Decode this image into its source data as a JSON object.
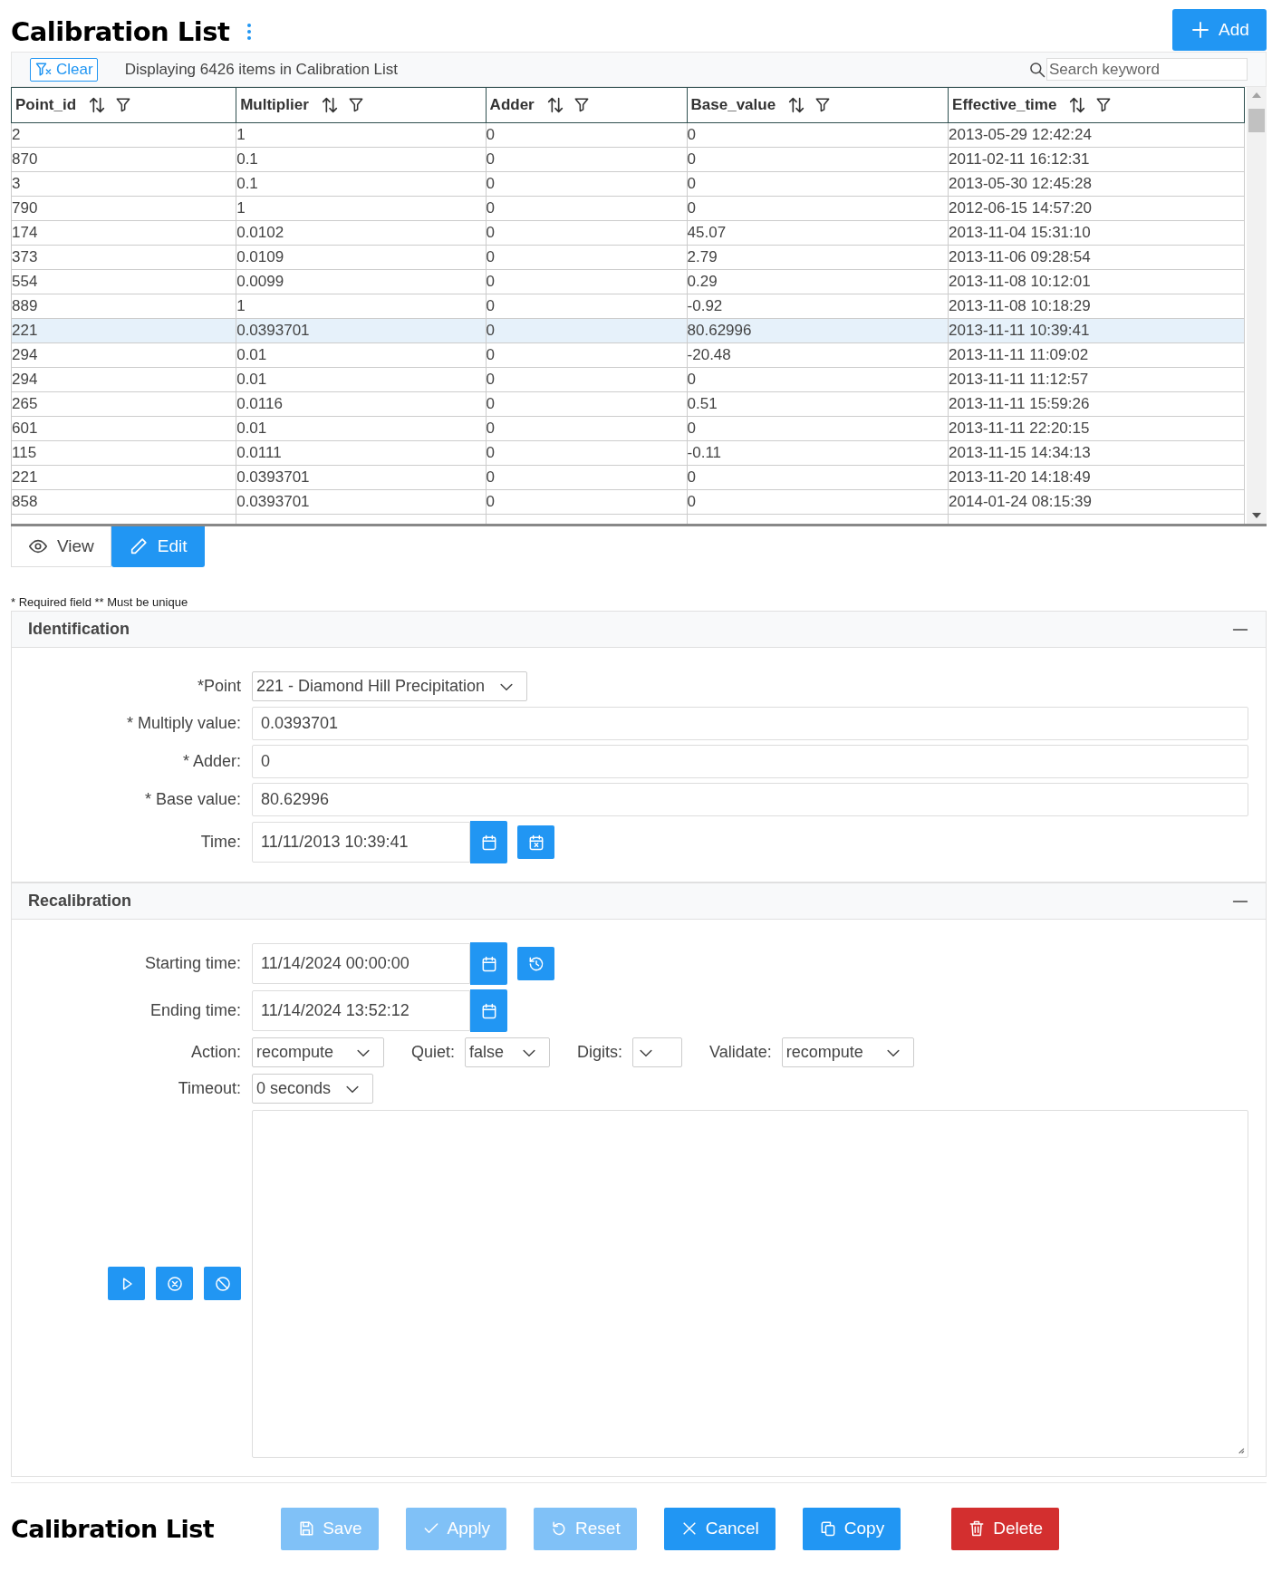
{
  "header": {
    "title": "Calibration List",
    "add_label": "Add"
  },
  "toolbar": {
    "clear_label": "Clear",
    "summary": "Displaying 6426 items in Calibration List",
    "search_placeholder": "Search keyword"
  },
  "table": {
    "columns": [
      "Point_id",
      "Multiplier",
      "Adder",
      "Base_value",
      "Effective_time"
    ],
    "rows": [
      {
        "cells": [
          "2",
          "1",
          "0",
          "0",
          "2013-05-29 12:42:24"
        ],
        "selected": false
      },
      {
        "cells": [
          "870",
          "0.1",
          "0",
          "0",
          "2011-02-11 16:12:31"
        ],
        "selected": false
      },
      {
        "cells": [
          "3",
          "0.1",
          "0",
          "0",
          "2013-05-30 12:45:28"
        ],
        "selected": false
      },
      {
        "cells": [
          "790",
          "1",
          "0",
          "0",
          "2012-06-15 14:57:20"
        ],
        "selected": false
      },
      {
        "cells": [
          "174",
          "0.0102",
          "0",
          "45.07",
          "2013-11-04 15:31:10"
        ],
        "selected": false
      },
      {
        "cells": [
          "373",
          "0.0109",
          "0",
          "2.79",
          "2013-11-06 09:28:54"
        ],
        "selected": false
      },
      {
        "cells": [
          "554",
          "0.0099",
          "0",
          "0.29",
          "2013-11-08 10:12:01"
        ],
        "selected": false
      },
      {
        "cells": [
          "889",
          "1",
          "0",
          "-0.92",
          "2013-11-08 10:18:29"
        ],
        "selected": false
      },
      {
        "cells": [
          "221",
          "0.0393701",
          "0",
          "80.62996",
          "2013-11-11 10:39:41"
        ],
        "selected": true
      },
      {
        "cells": [
          "294",
          "0.01",
          "0",
          "-20.48",
          "2013-11-11 11:09:02"
        ],
        "selected": false
      },
      {
        "cells": [
          "294",
          "0.01",
          "0",
          "0",
          "2013-11-11 11:12:57"
        ],
        "selected": false
      },
      {
        "cells": [
          "265",
          "0.0116",
          "0",
          "0.51",
          "2013-11-11 15:59:26"
        ],
        "selected": false
      },
      {
        "cells": [
          "601",
          "0.01",
          "0",
          "0",
          "2013-11-11 22:20:15"
        ],
        "selected": false
      },
      {
        "cells": [
          "115",
          "0.0111",
          "0",
          "-0.11",
          "2013-11-15 14:34:13"
        ],
        "selected": false
      },
      {
        "cells": [
          "221",
          "0.0393701",
          "0",
          "0",
          "2013-11-20 14:18:49"
        ],
        "selected": false
      },
      {
        "cells": [
          "858",
          "0.0393701",
          "0",
          "0",
          "2014-01-24 08:15:39"
        ],
        "selected": false
      }
    ]
  },
  "tabs": [
    {
      "label": "View",
      "kind": "view",
      "selected": false
    },
    {
      "label": "Edit",
      "kind": "edit",
      "selected": true
    }
  ],
  "legend": "* Required field ** Must be unique",
  "panels": [
    {
      "title": "Identification",
      "expanded": true,
      "fields": [
        {
          "kind": "select",
          "label": "*Point",
          "value": "221 - Diamond Hill Precipitation"
        },
        {
          "kind": "text",
          "label": "* Multiply value:",
          "value": "0.0393701"
        },
        {
          "kind": "text",
          "label": "* Adder:",
          "value": "0"
        },
        {
          "kind": "text",
          "label": "* Base value:",
          "value": "80.62996"
        },
        {
          "kind": "datetime",
          "label": "Time:",
          "value": "11/11/2013 10:39:41",
          "actions": [
            {
              "kind": "clear-date"
            }
          ]
        }
      ]
    },
    {
      "title": "Recalibration",
      "expanded": true,
      "fields": [
        {
          "kind": "datetime",
          "label": "Starting time:",
          "value": "11/14/2024 00:00:00",
          "actions": [
            {
              "kind": "history"
            }
          ]
        },
        {
          "kind": "datetime",
          "label": "Ending time:",
          "value": "11/14/2024 13:52:12"
        },
        {
          "kind": "select-row",
          "selects": [
            {
              "label": "Action:",
              "value": "recompute"
            },
            {
              "label": "Quiet:",
              "value": "false"
            },
            {
              "label": "Digits:"
            },
            {
              "label": "Validate:",
              "value": "recompute"
            }
          ]
        },
        {
          "kind": "select",
          "label": "Timeout:",
          "value": "0 seconds"
        },
        {
          "kind": "output",
          "buttons": [
            {
              "kind": "play"
            },
            {
              "kind": "stop"
            },
            {
              "kind": "abort"
            }
          ]
        }
      ]
    }
  ],
  "footer": {
    "title": "Calibration List",
    "buttons": [
      {
        "label": "Save",
        "kind": "save",
        "disabled": true
      },
      {
        "label": "Apply",
        "kind": "apply",
        "disabled": true
      },
      {
        "label": "Reset",
        "kind": "reset",
        "disabled": true
      },
      {
        "label": "Cancel",
        "kind": "cancel",
        "disabled": false
      },
      {
        "label": "Copy",
        "kind": "copy",
        "disabled": false
      },
      {
        "label": "Delete",
        "kind": "delete",
        "disabled": false
      }
    ]
  }
}
